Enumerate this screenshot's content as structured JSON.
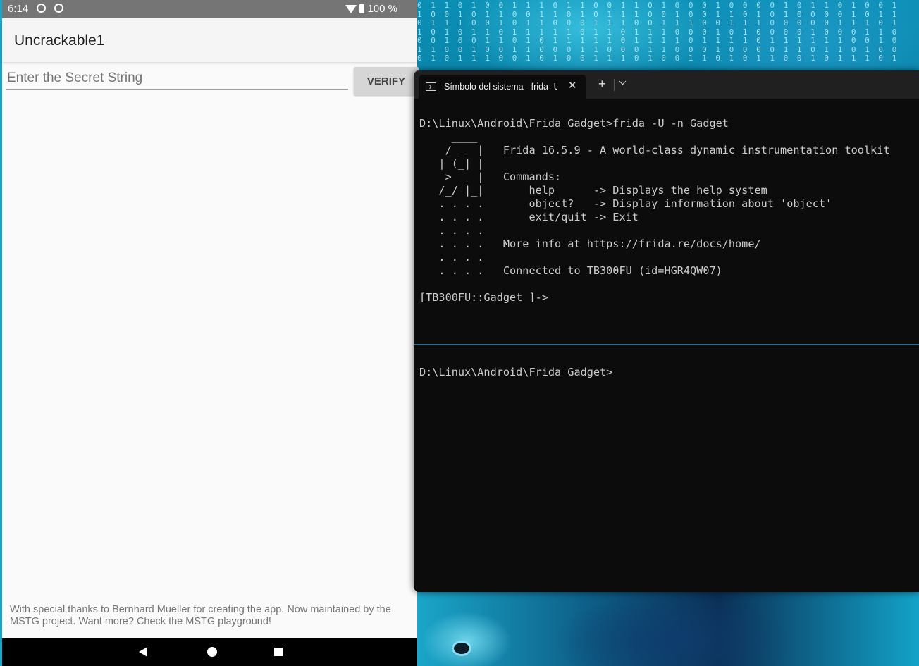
{
  "android": {
    "status_bar": {
      "time": "6:14",
      "battery": "100 %"
    },
    "app_title": "Uncrackable1",
    "secret_input": {
      "placeholder": "Enter the Secret String",
      "value": ""
    },
    "verify_label": "VERIFY",
    "footer": "With special thanks to Bernhard Mueller for creating the app. Now maintained by the MSTG project. Want more? Check the MSTG playground!"
  },
  "terminal": {
    "tab_title": "Símbolo del sistema - frida  -U",
    "tab_close": "✕",
    "new_tab": "+",
    "top_pane_lines": [
      "D:\\Linux\\Android\\Frida Gadget>frida -U -n Gadget",
      "     ____",
      "    / _  |   Frida 16.5.9 - A world-class dynamic instrumentation toolkit",
      "   | (_| |",
      "    > _  |   Commands:",
      "   /_/ |_|       help      -> Displays the help system",
      "   . . . .       object?   -> Display information about 'object'",
      "   . . . .       exit/quit -> Exit",
      "   . . . .",
      "   . . . .   More info at https://frida.re/docs/home/",
      "   . . . .",
      "   . . . .   Connected to TB300FU (id=HGR4QW07)",
      "",
      "[TB300FU::Gadget ]->"
    ],
    "bottom_pane_lines": [
      "D:\\Linux\\Android\\Frida Gadget>"
    ]
  },
  "wallpaper": {
    "binary_rows": [
      "0 1 1 0 1 0 0 1 1 1 0 1 1 0 0 1 1 0 1 0 0 0 1 0 0 0 0 1 0 1 1 0 1 0 0 1",
      "1 0 0 1 0 1 1 0 0 1 1 0 1 0 1 1 1 0 0 1 0 0 1 1 0 1 0 1 0 0 0 0 1 0 1 1",
      "0 1 1 1 0 0 1 0 1 1 0 0 0 1 1 1 0 0 1 1 1 0 0 1 1 1 0 0 0 0 0 1 1 1 0 1",
      "1 0 1 0 1 1 0 1 1 1 1 1 0 1 1 0 1 1 1 0 0 0 1 0 1 0 0 0 0 1 0 0 0 1 1 0",
      "0 0 1 0 0 1 1 0 1 0 1 1 1 1 1 0 1 1 1 1 0 1 1 1 1 0 1 1 1 1 1 1 0 0 1 0",
      "1 1 0 0 1 0 0 1 1 0 0 0 1 1 0 0 0 1 1 0 0 0 1 0 0 0 0 1 1 0 1 1 0 1 0 0",
      "0 1 0 1 1 1 0 0 1 0 1 0 0 1 1 1 0 1 0 0 1 1 0 1 0 1 1 0 0 1 0 1 1 1 0 1"
    ]
  }
}
